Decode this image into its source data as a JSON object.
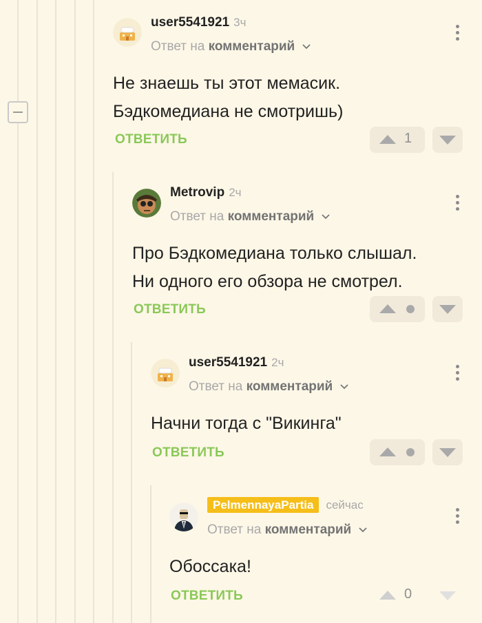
{
  "comments": [
    {
      "username": "user5541921",
      "time": "3ч",
      "reply_prefix": "Ответ на",
      "reply_link": "комментарий",
      "text_lines": [
        "Не знаешь ты этот мемасик.",
        "Бэдкомедиана не смотришь)"
      ],
      "reply_label": "ОТВЕТИТЬ",
      "score": "1"
    },
    {
      "username": "Metrovip",
      "time": "2ч",
      "reply_prefix": "Ответ на",
      "reply_link": "комментарий",
      "text_lines": [
        "Про Бэдкомедиана только слышал.",
        "Ни одного его обзора не смотрел."
      ],
      "reply_label": "ОТВЕТИТЬ"
    },
    {
      "username": "user5541921",
      "time": "2ч",
      "reply_prefix": "Ответ на",
      "reply_link": "комментарий",
      "text_lines": [
        "Начни тогда с \"Викинга\""
      ],
      "reply_label": "ОТВЕТИТЬ"
    },
    {
      "username": "PelmennayaPartia",
      "time": "сейчас",
      "reply_prefix": "Ответ на",
      "reply_link": "комментарий",
      "text_lines": [
        "Обоссака!"
      ],
      "reply_label": "ОТВЕТИТЬ",
      "score": "0"
    }
  ],
  "icons": {
    "collapse": "minus-icon",
    "more": "more-vertical-icon",
    "vote_up": "triangle-up-icon",
    "vote_down": "triangle-down-icon",
    "chevron": "chevron-down-icon"
  },
  "colors": {
    "background": "#fdf7e7",
    "reply_button": "#8ac858",
    "author_badge": "#f5be19"
  }
}
